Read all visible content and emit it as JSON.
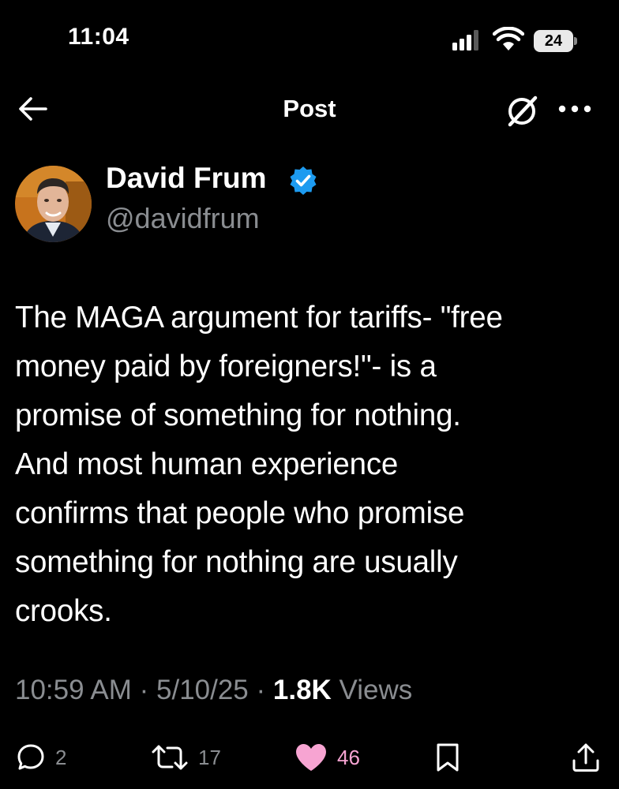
{
  "status_bar": {
    "time": "11:04",
    "battery": "24",
    "icons": [
      "cellular-signal-icon",
      "wifi-icon",
      "battery-icon"
    ]
  },
  "header": {
    "title": "Post",
    "icons": [
      "back-arrow-icon",
      "grok-icon",
      "more-options-icon"
    ]
  },
  "author": {
    "name": "David Frum",
    "handle": "@davidfrum",
    "verified": true,
    "verified_color": "#1d9bf0"
  },
  "tweet": {
    "text": "The MAGA argument for tariffs- \"free\nmoney paid by foreigners!\"- is a\npromise of something for nothing.\nAnd most human experience\nconfirms that people who promise\nsomething for nothing are usually\ncrooks."
  },
  "meta": {
    "time": "10:59 AM",
    "separator": " · ",
    "date": "5/10/25",
    "views_count": "1.8K",
    "views_label": " Views"
  },
  "actions": {
    "replies": "2",
    "reposts": "17",
    "likes": "46",
    "liked": true,
    "like_color": "#f7a4d2",
    "icons": [
      "reply-icon",
      "repost-icon",
      "like-heart-icon",
      "bookmark-icon",
      "share-icon"
    ]
  },
  "colors": {
    "background": "#000000",
    "text": "#ffffff",
    "secondary_text": "#8a8d91",
    "verified": "#1d9bf0"
  }
}
